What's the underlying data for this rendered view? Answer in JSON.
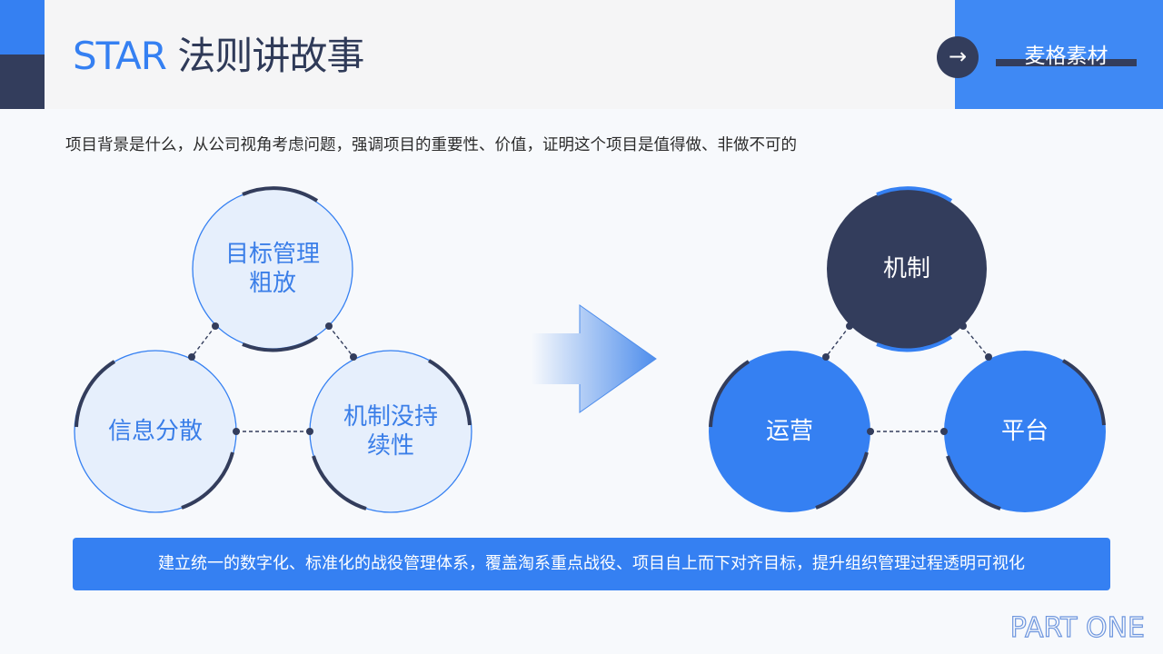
{
  "header": {
    "title_accent": "STAR",
    "title_rest": " 法则讲故事",
    "brand": "麦格素材",
    "arrow": "→"
  },
  "subtitle": "项目背景是什么，从公司视角考虑问题，强调项目的重要性、价值，证明这个项目是值得做、非做不可的",
  "left_diagram": {
    "top": [
      "目标管理",
      "粗放"
    ],
    "left": "信息分散",
    "right": [
      "机制没持",
      "续性"
    ]
  },
  "right_diagram": {
    "top": "机制",
    "left": "运营",
    "right": "平台"
  },
  "banner": "建立统一的数字化、标准化的战役管理体系，覆盖淘系重点战役、项目自上而下对齐目标，提升组织管理过程透明可视化",
  "footer": "PART ONE",
  "colors": {
    "accent": "#3580f2",
    "dark": "#333d5c",
    "light_fill": "#e6effc"
  }
}
